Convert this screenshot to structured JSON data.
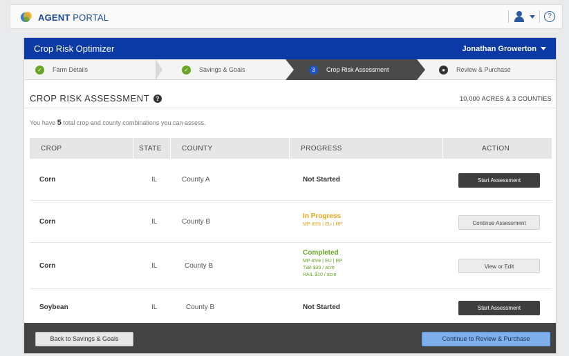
{
  "portal": {
    "name_bold": "AGENT",
    "name_rest": " PORTAL",
    "user_icon": "user-icon",
    "help_icon": "help-icon",
    "help_glyph": "?"
  },
  "app": {
    "title": "Crop Risk Optimizer",
    "user_name": "Jonathan Growerton"
  },
  "steps": [
    {
      "label": "Farm Details",
      "state": "done"
    },
    {
      "label": "Savings & Goals",
      "state": "done"
    },
    {
      "num": "3",
      "label": "Crop Risk Assessment",
      "state": "current"
    },
    {
      "label": "Review & Purchase",
      "state": "todo"
    }
  ],
  "section": {
    "title": "CROP RISK ASSESSMENT",
    "help_glyph": "?",
    "acres_summary": "10,000 ACRES & 3 COUNTIES",
    "intro_before": "You have ",
    "intro_count": "5",
    "intro_after": " total crop and county combinations you can assess."
  },
  "table": {
    "headers": {
      "crop": "CROP",
      "state": "STATE",
      "county": "COUNTY",
      "progress": "PROGRESS",
      "action": "ACTION"
    },
    "rows": [
      {
        "crop": "Corn",
        "state": "IL",
        "county": "County A",
        "progress": "Not Started",
        "progress_detail": [],
        "action": "Start Assessment",
        "status": "not-started"
      },
      {
        "crop": "Corn",
        "state": "IL",
        "county": "County B",
        "progress": "In Progress",
        "progress_detail": [
          "MP 85% | EU | RP"
        ],
        "action": "Continue Assessment",
        "status": "in-progress"
      },
      {
        "crop": "Corn",
        "state": "IL",
        "county": "County B",
        "progress": "Completed",
        "progress_detail": [
          "MP 85% | EU | RP",
          "TWI $30 / acre",
          "HAIL $10 / acre"
        ],
        "action": "View or Edit",
        "status": "completed"
      },
      {
        "crop": "Soybean",
        "state": "IL",
        "county": "County B",
        "progress": "Not Started",
        "progress_detail": [],
        "action": "Start Assessment",
        "status": "not-started"
      }
    ]
  },
  "footer": {
    "back_label": "Back to Savings & Goals",
    "next_label": "Continue to Review & Purchase"
  },
  "colors": {
    "header_blue": "#0b3aa6",
    "done_green": "#6aa525",
    "in_progress_orange": "#e5a41a",
    "primary_button": "#7fb0ec"
  }
}
